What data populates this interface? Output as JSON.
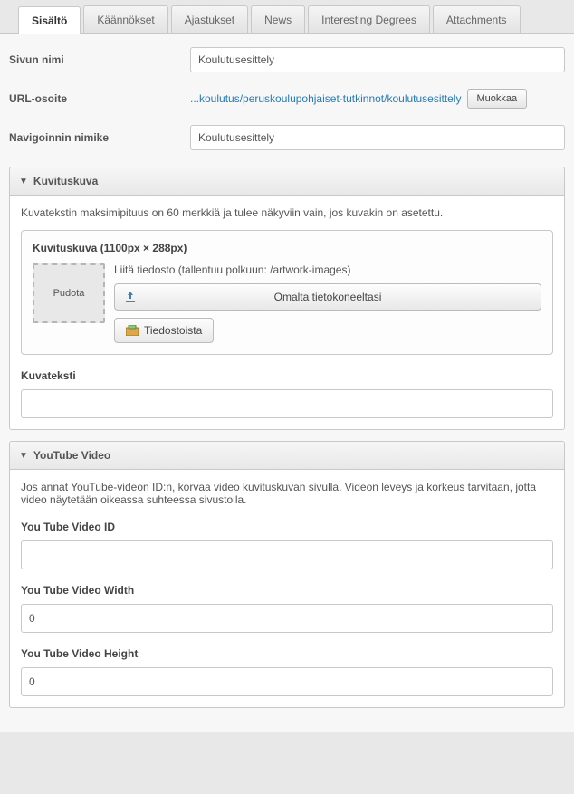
{
  "tabs": [
    {
      "label": "Sisältö",
      "active": true
    },
    {
      "label": "Käännökset",
      "active": false
    },
    {
      "label": "Ajastukset",
      "active": false
    },
    {
      "label": "News",
      "active": false
    },
    {
      "label": "Interesting Degrees",
      "active": false
    },
    {
      "label": "Attachments",
      "active": false
    }
  ],
  "fields": {
    "page_name_label": "Sivun nimi",
    "page_name_value": "Koulutusesittely",
    "url_label": "URL-osoite",
    "url_value": "...koulutus/peruskoulupohjaiset-tutkinnot/koulutusesittely",
    "url_edit_btn": "Muokkaa",
    "nav_label": "Navigoinnin nimike",
    "nav_value": "Koulutusesittely"
  },
  "illustration": {
    "header": "Kuvituskuva",
    "help": "Kuvatekstin maksimipituus on 60 merkkiä ja tulee näkyviin vain, jos kuvakin on asetettu.",
    "box_title": "Kuvituskuva (1100px × 288px)",
    "drop_label": "Pudota",
    "attach_label": "Liitä tiedosto (tallentuu polkuun: /artwork-images)",
    "from_computer": "Omalta tietokoneeltasi",
    "from_files": "Tiedostoista",
    "caption_label": "Kuvateksti",
    "caption_value": ""
  },
  "youtube": {
    "header": "YouTube Video",
    "help": "Jos annat YouTube-videon ID:n, korvaa video kuvituskuvan sivulla. Videon leveys ja korkeus tarvitaan, jotta video näytetään oikeassa suhteessa sivustolla.",
    "id_label": "You Tube Video ID",
    "id_value": "",
    "width_label": "You Tube Video Width",
    "width_value": "0",
    "height_label": "You Tube Video Height",
    "height_value": "0"
  }
}
